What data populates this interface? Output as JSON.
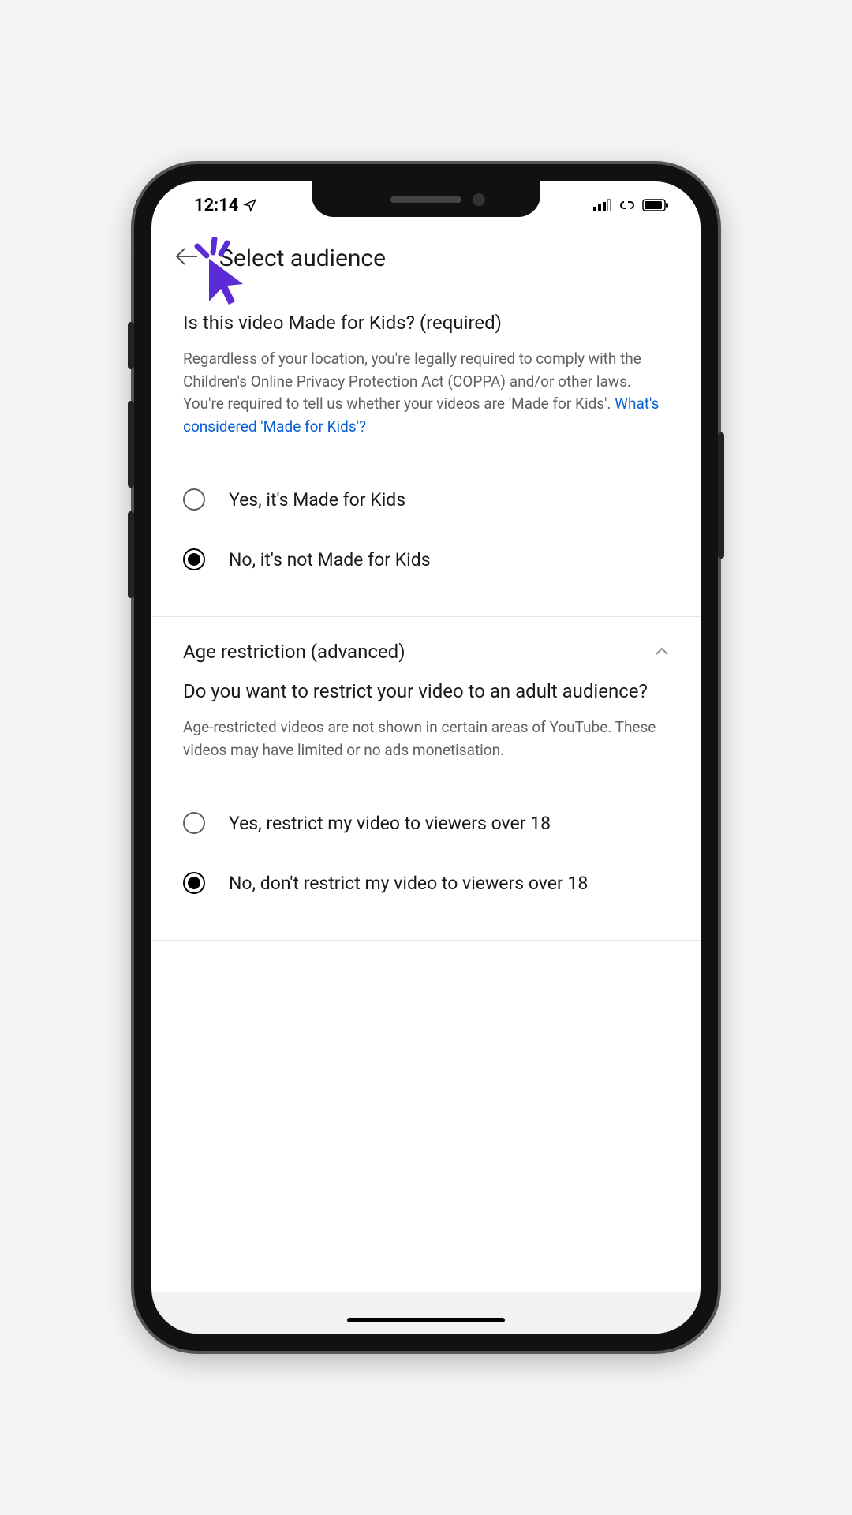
{
  "status": {
    "time": "12:14",
    "location_icon": "location-arrow"
  },
  "header": {
    "title": "Select audience"
  },
  "made_for_kids": {
    "title": "Is this video Made for Kids? (required)",
    "description": "Regardless of your location, you're legally required to comply with the Children's Online Privacy Protection Act (COPPA) and/or other laws. You're required to tell us whether your videos are 'Made for Kids'. ",
    "link_text": "What's considered 'Made for Kids'?",
    "options": [
      {
        "label": "Yes, it's Made for Kids",
        "selected": false
      },
      {
        "label": "No, it's not Made for Kids",
        "selected": true
      }
    ]
  },
  "age_restriction": {
    "accordion_title": "Age restriction (advanced)",
    "question": "Do you want to restrict your video to an adult audience?",
    "description": "Age-restricted videos are not shown in certain areas of YouTube. These videos may have limited or no ads monetisation.",
    "options": [
      {
        "label": "Yes, restrict my video to viewers over 18",
        "selected": false
      },
      {
        "label": "No, don't restrict my video to viewers over 18",
        "selected": true
      }
    ]
  }
}
